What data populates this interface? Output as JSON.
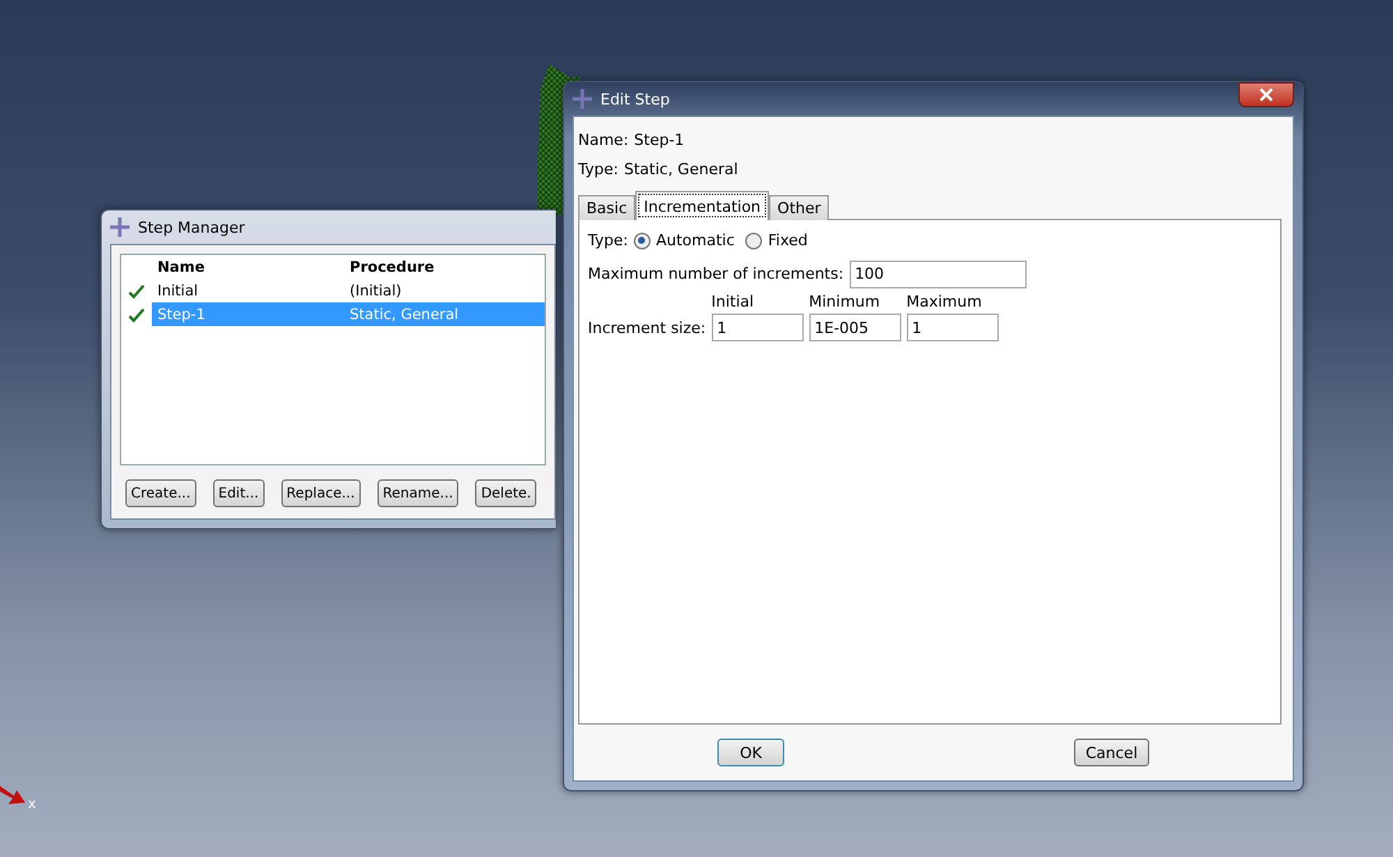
{
  "step_manager": {
    "title": "Step Manager",
    "columns": [
      "Name",
      "Procedure"
    ],
    "rows": [
      {
        "name": "Initial",
        "procedure": "(Initial)",
        "checked": true,
        "selected": false
      },
      {
        "name": "Step-1",
        "procedure": "Static, General",
        "checked": true,
        "selected": true
      }
    ],
    "buttons": [
      "Create...",
      "Edit...",
      "Replace...",
      "Rename...",
      "Delete."
    ]
  },
  "edit_step": {
    "title": "Edit Step",
    "name_label": "Name:",
    "name": "Step-1",
    "type_label": "Type:",
    "type": "Static, General",
    "tabs": [
      {
        "label": "Basic",
        "selected": false
      },
      {
        "label": "Incrementation",
        "selected": true
      },
      {
        "label": "Other",
        "selected": false
      }
    ],
    "inc_type_label": "Type:",
    "inc_types": [
      {
        "label": "Automatic",
        "selected": true
      },
      {
        "label": "Fixed",
        "selected": false
      }
    ],
    "max_increments_label": "Maximum number of increments:",
    "max_increments": "100",
    "size_headers": [
      "Initial",
      "Minimum",
      "Maximum"
    ],
    "size_label": "Increment size:",
    "sizes": [
      "1",
      "1E-005",
      "1"
    ],
    "buttons": [
      "OK",
      "Cancel"
    ]
  },
  "triad_label": "x"
}
